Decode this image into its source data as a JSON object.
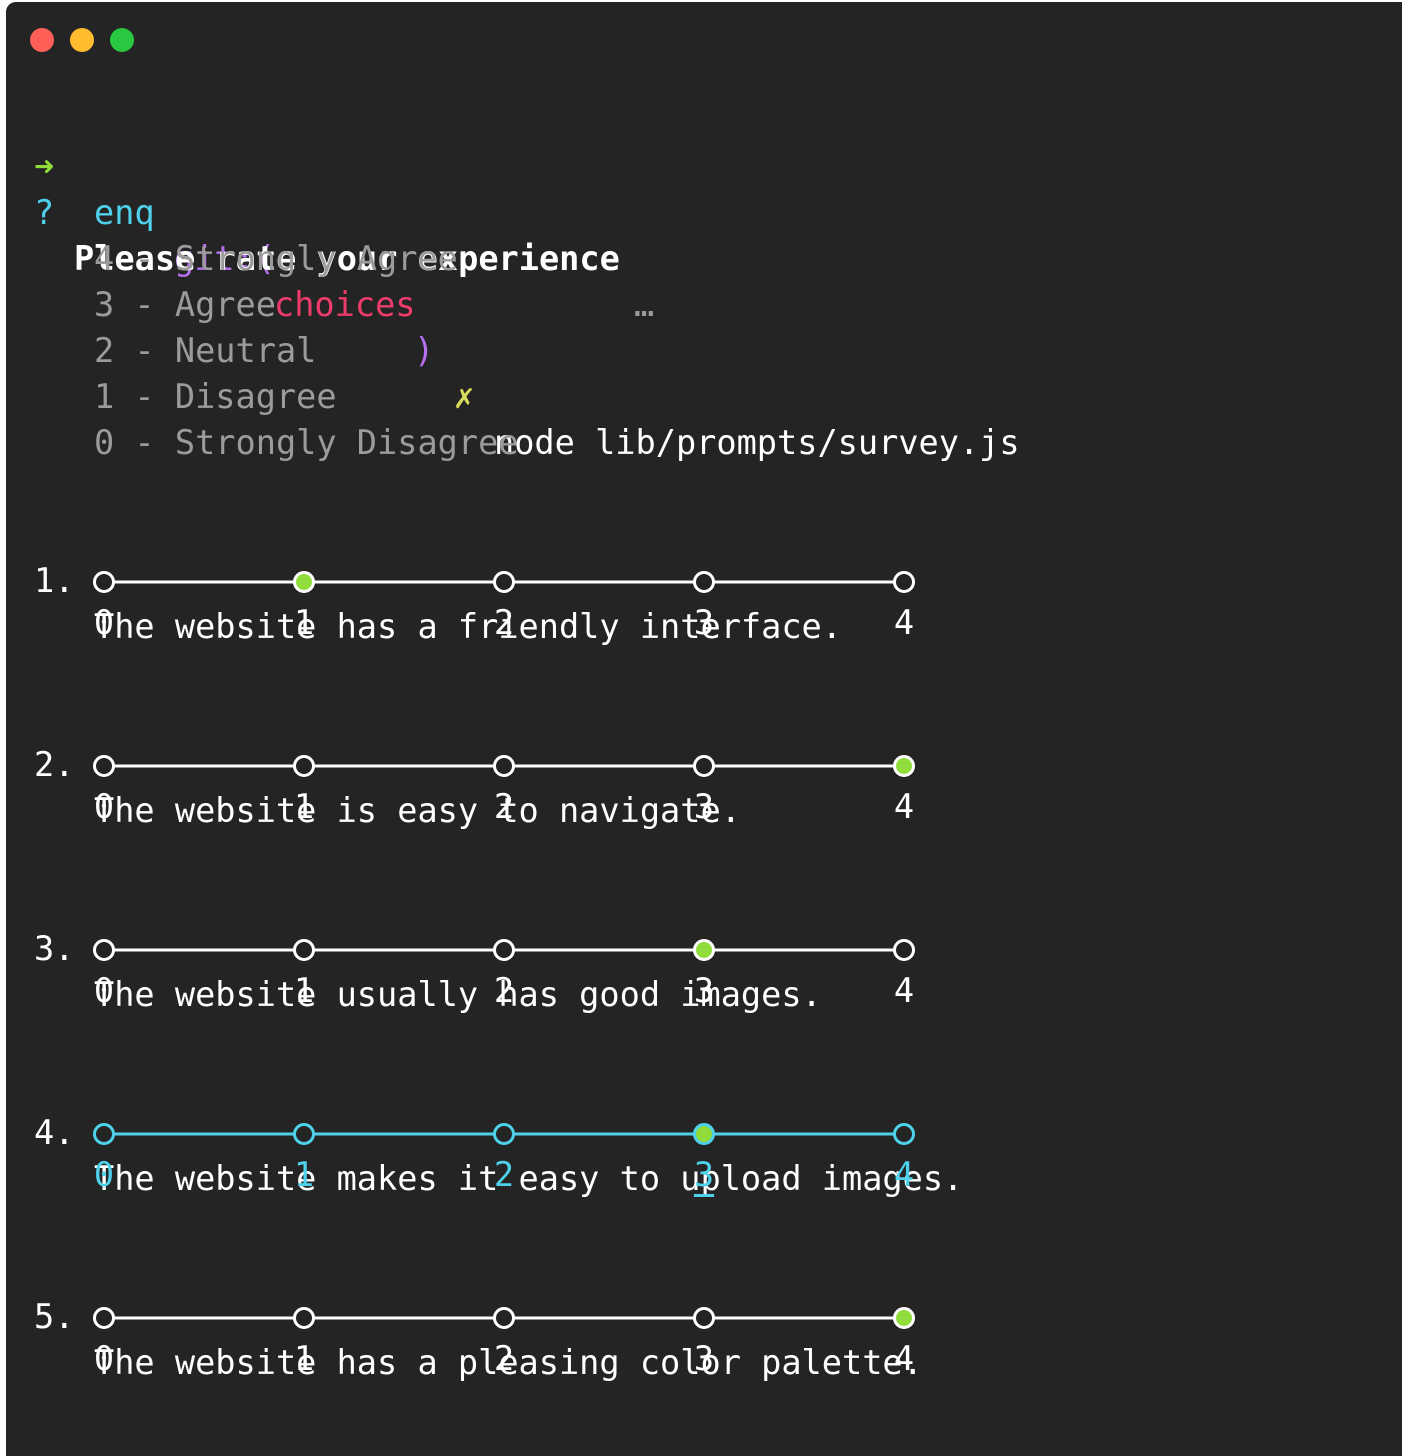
{
  "terminal": {
    "prompt_arrow": "➜",
    "dir": "enq",
    "git_label": "git:(",
    "branch": "choices",
    "git_close": ")",
    "dirty_mark": "✗",
    "command": "node lib/prompts/survey.js"
  },
  "question": {
    "mark": "?",
    "message": "Please rate your experience",
    "ellipsis": "…"
  },
  "legend": [
    "4 - Strongly Agree",
    "3 - Agree",
    "2 - Neutral",
    "1 - Disagree",
    "0 - Strongly Disagree"
  ],
  "scale_labels": [
    "0",
    "1",
    "2",
    "3",
    "4"
  ],
  "items": [
    {
      "number": "1.",
      "text": "The website has a friendly interface.",
      "value": 1,
      "active": false
    },
    {
      "number": "2.",
      "text": "The website is easy to navigate.",
      "value": 4,
      "active": false
    },
    {
      "number": "3.",
      "text": "The website usually has good images.",
      "value": 3,
      "active": false
    },
    {
      "number": "4.",
      "text": "The website makes it easy to upload images.",
      "value": 3,
      "active": true
    },
    {
      "number": "5.",
      "text": "The website has a pleasing color palette.",
      "value": 4,
      "active": false
    }
  ],
  "colors": {
    "background": "#242424",
    "text": "#ffffff",
    "dim": "#9b9b9b",
    "cyan": "#4fd1ec",
    "green": "#8fdc3b",
    "purple": "#b86ff0",
    "red": "#ef3b6a",
    "yellow": "#d9dd5e",
    "light_close": "#fe5f57",
    "light_min": "#febc2e",
    "light_max": "#28c840"
  }
}
